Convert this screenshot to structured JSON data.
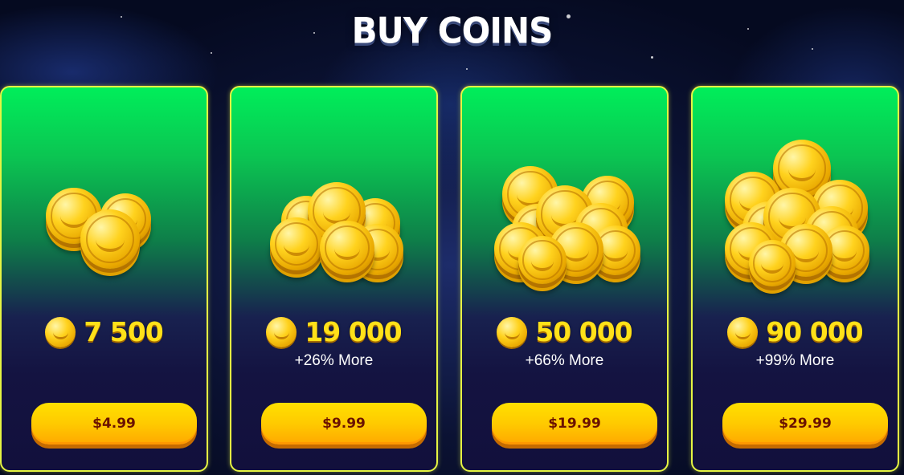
{
  "title": "BUY COINS",
  "packs": [
    {
      "amount": "7 500",
      "bonus": "",
      "price": "$4.99",
      "coin_count": 3
    },
    {
      "amount": "19 000",
      "bonus": "+26% More",
      "price": "$9.99",
      "coin_count": 6
    },
    {
      "amount": "50 000",
      "bonus": "+66% More",
      "price": "$19.99",
      "coin_count": 9
    },
    {
      "amount": "90 000",
      "bonus": "+99% More",
      "price": "$29.99",
      "coin_count": 12
    }
  ],
  "colors": {
    "card_border": "#e6f542",
    "card_top": "#00ee5a",
    "card_bottom": "#12103c",
    "amount_text": "#ffe119",
    "button": "#ffca00",
    "button_text": "#6b1200"
  },
  "icons": {
    "coin": "banana-coin-icon"
  }
}
